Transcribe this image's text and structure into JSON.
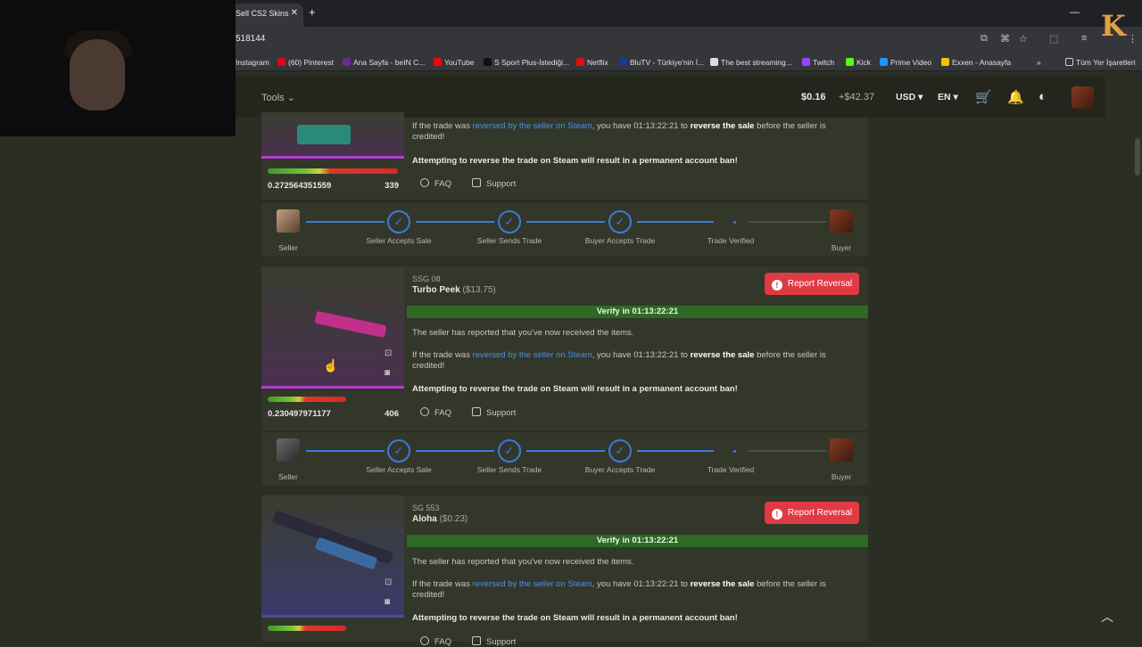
{
  "browser": {
    "tab_title": "Sell CS2 Skins",
    "url": "518144",
    "bookmarks": [
      "Instagram",
      "(60) Pinterest",
      "Ana Sayfa - beIN C...",
      "YouTube",
      "S Sport Plus-İstediği...",
      "Netflix",
      "BluTV - Türkiye'nin İ...",
      "The best streaming...",
      "Twitch",
      "Kick",
      "Prime Video",
      "Exxen - Anasayfa",
      "Tüm Yer İşaretleri"
    ]
  },
  "header": {
    "tools_label": "Tools",
    "balance": "$0.16",
    "delta": "+$42.37",
    "currency": "USD",
    "language": "EN"
  },
  "cards": [
    {
      "float": "0.272564351559",
      "pattern": "339",
      "reverse_text_pre": "If the trade was ",
      "reverse_link": "reversed by the seller on Steam",
      "reverse_text_mid": ", you have 01:13:22:21 to ",
      "reverse_strong": "reverse the sale",
      "reverse_text_post": " before the seller is credited!",
      "warning": "Attempting to reverse the trade on Steam will result in a permanent account ban!",
      "faq": "FAQ",
      "support": "Support"
    },
    {
      "item_type": "SSG 08",
      "item_name": "Turbo Peek",
      "item_price": "($13.75)",
      "report": "Report Reversal",
      "verify": "Verify in 01:13:22:21",
      "received": "The seller has reported that you've now received the items.",
      "reverse_text_pre": "If the trade was ",
      "reverse_link": "reversed by the seller on Steam",
      "reverse_text_mid": ", you have 01:13:22:21 to ",
      "reverse_strong": "reverse the sale",
      "reverse_text_post": " before the seller is credited!",
      "warning": "Attempting to reverse the trade on Steam will result in a permanent account ban!",
      "faq": "FAQ",
      "support": "Support",
      "float": "0.230497971177",
      "pattern": "406"
    },
    {
      "item_type": "SG 553",
      "item_name": "Aloha",
      "item_price": "($0.23)",
      "report": "Report Reversal",
      "verify": "Verify in 01:13:22:21",
      "received": "The seller has reported that you've now received the items.",
      "reverse_text_pre": "If the trade was ",
      "reverse_link": "reversed by the seller on Steam",
      "reverse_text_mid": ", you have 01:13:22:21 to ",
      "reverse_strong": "reverse the sale",
      "reverse_text_post": " before the seller is credited!",
      "warning": "Attempting to reverse the trade on Steam will result in a permanent account ban!",
      "faq": "FAQ",
      "support": "Support"
    }
  ],
  "steps": [
    "Seller",
    "Seller Accepts Sale",
    "Seller Sends Trade",
    "Buyer Accepts Trade",
    "Trade Verified",
    "Buyer"
  ],
  "colors": {
    "accent_blue": "#3a7ae0",
    "report_red": "#e03a44",
    "verify_green": "#2e6a24"
  }
}
